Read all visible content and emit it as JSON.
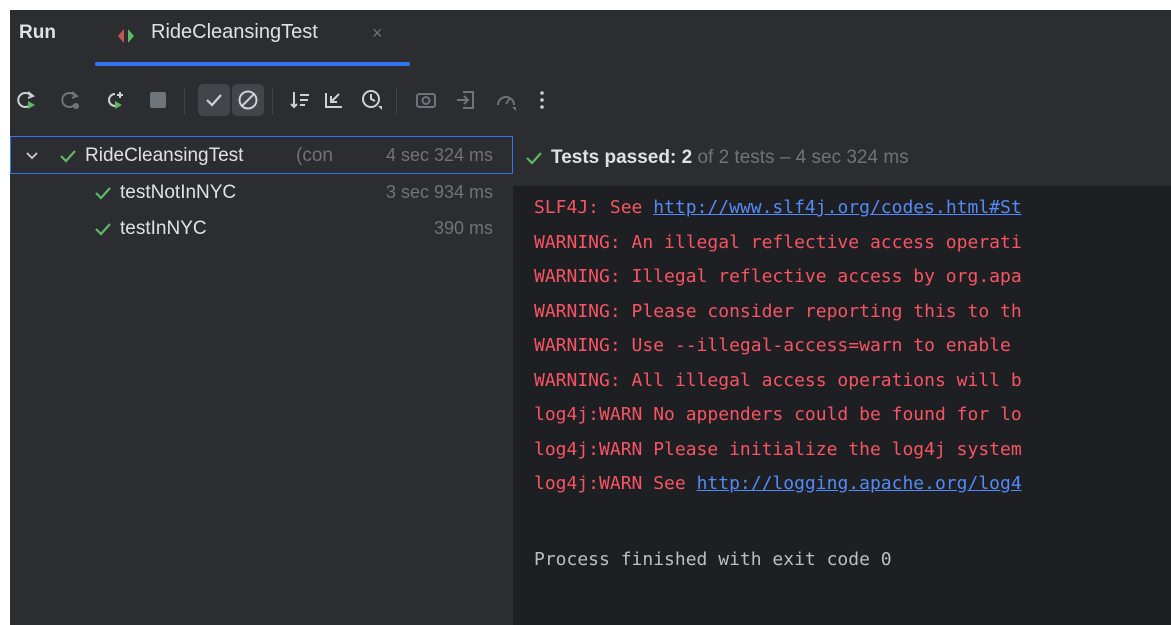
{
  "tabbar": {
    "run_label": "Run",
    "tab_title": "RideCleansingTest",
    "tab_icon": "run-config-icon",
    "close_glyph": "×"
  },
  "toolbar": {
    "buttons": [
      {
        "name": "rerun-icon"
      },
      {
        "name": "rerun-failed-icon"
      },
      {
        "name": "toggle-auto-test-icon"
      },
      {
        "name": "stop-icon"
      },
      {
        "name": "show-passed-icon",
        "toggled": true
      },
      {
        "name": "show-ignored-icon",
        "toggled": true
      },
      {
        "name": "sort-alphabetically-icon"
      },
      {
        "name": "collapse-all-icon"
      },
      {
        "name": "sort-by-duration-icon"
      },
      {
        "name": "screenshot-icon"
      },
      {
        "name": "import-tests-icon"
      },
      {
        "name": "coverage-icon"
      },
      {
        "name": "more-options-icon"
      }
    ]
  },
  "tree": {
    "root": {
      "name": "RideCleansingTest",
      "extra": "(con",
      "time": "4 sec 324 ms"
    },
    "children": [
      {
        "name": "testNotInNYC",
        "time": "3 sec 934 ms"
      },
      {
        "name": "testInNYC",
        "time": "390 ms"
      }
    ]
  },
  "console": {
    "header": {
      "label": "Tests passed:",
      "count": "2",
      "rest": "of 2 tests – 4 sec 324 ms"
    },
    "lines": [
      {
        "prefix": "SLF4J: See ",
        "link": "http://www.slf4j.org/codes.html#St"
      },
      {
        "text": "WARNING: An illegal reflective access operati"
      },
      {
        "text": "WARNING: Illegal reflective access by org.apa"
      },
      {
        "text": "WARNING: Please consider reporting this to th"
      },
      {
        "text": "WARNING: Use --illegal-access=warn to enable "
      },
      {
        "text": "WARNING: All illegal access operations will b"
      },
      {
        "text": "log4j:WARN No appenders could be found for lo"
      },
      {
        "text": "log4j:WARN Please initialize the log4j system"
      },
      {
        "prefix": "log4j:WARN See ",
        "link": "http://logging.apache.org/log4"
      },
      {
        "text": "Process finished with exit code 0"
      }
    ]
  },
  "colors": {
    "background": "#2b2d30",
    "console_bg": "#1e1f22",
    "accent": "#3574f0",
    "success": "#5fb865",
    "error_text": "#f75464",
    "link": "#548af7"
  }
}
